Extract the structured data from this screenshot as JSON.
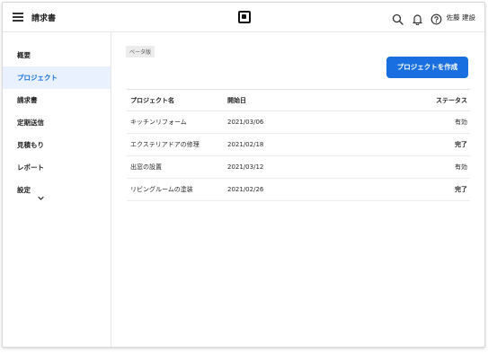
{
  "header": {
    "app_title": "請求書",
    "user_name": "佐藤 建設"
  },
  "sidebar": {
    "items": [
      {
        "label": "概要",
        "active": false
      },
      {
        "label": "プロジェクト",
        "active": true
      },
      {
        "label": "請求書",
        "active": false
      },
      {
        "label": "定期送信",
        "active": false
      },
      {
        "label": "見積もり",
        "active": false
      },
      {
        "label": "レポート",
        "active": false
      },
      {
        "label": "設定",
        "active": false,
        "has_chevron": true
      }
    ]
  },
  "main": {
    "beta_badge": "ベータ版",
    "create_button": "プロジェクトを作成",
    "table": {
      "headers": [
        "プロジェクト名",
        "開始日",
        "ステータス"
      ],
      "rows": [
        {
          "name": "キッチンリフォーム",
          "date": "2021/03/06",
          "status": "有効",
          "status_type": "active"
        },
        {
          "name": "エクステリアドアの修理",
          "date": "2021/02/18",
          "status": "完了",
          "status_type": "done"
        },
        {
          "name": "出窓の設置",
          "date": "2021/03/12",
          "status": "有効",
          "status_type": "active"
        },
        {
          "name": "リビングルームの塗装",
          "date": "2021/02/26",
          "status": "完了",
          "status_type": "done"
        }
      ]
    }
  },
  "colors": {
    "accent": "#1a6fe0",
    "active_nav_bg": "#e8f1fd",
    "status_done": "#1fa84a"
  },
  "icons": [
    "menu-icon",
    "square-logo-icon",
    "search-icon",
    "bell-icon",
    "help-icon",
    "chevron-down-icon"
  ]
}
